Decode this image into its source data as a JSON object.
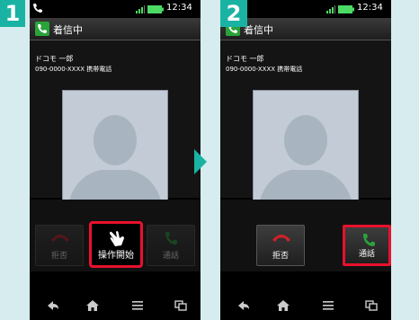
{
  "steps": [
    {
      "number": "1",
      "status": {
        "time": "12:34"
      },
      "title": "着信中",
      "caller": {
        "name": "ドコモ 一郎",
        "number": "090-0000-XXXX 携帯電話"
      },
      "buttons": {
        "reject": "拒否",
        "start": "操作開始",
        "answer": "通話"
      }
    },
    {
      "number": "2",
      "status": {
        "time": "12:34"
      },
      "title": "着信中",
      "caller": {
        "name": "ドコモ 一郎",
        "number": "090-0000-XXXX 携帯電話"
      },
      "buttons": {
        "reject": "拒否",
        "answer": "通話"
      }
    }
  ],
  "colors": {
    "accent": "#1ab3a3",
    "highlight": "#e8112d",
    "answer": "#2aa33a",
    "reject": "#d3202a"
  },
  "icons": [
    "phone-icon",
    "signal-icon",
    "battery-icon",
    "hand-tap-icon",
    "back-icon",
    "home-icon",
    "menu-icon",
    "recent-apps-icon",
    "next-arrow-icon"
  ]
}
